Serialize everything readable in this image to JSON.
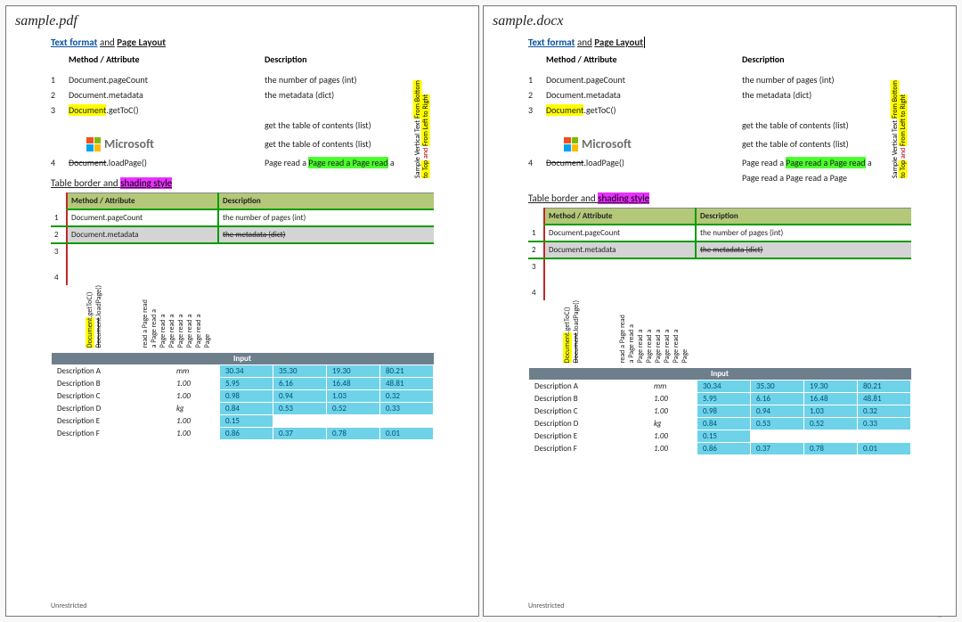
{
  "panes": [
    {
      "id": "left",
      "filename": "sample.pdf",
      "showCursor": false,
      "extraBottomRow": false
    },
    {
      "id": "right",
      "filename": "sample.docx",
      "showCursor": true,
      "extraBottomRow": true
    }
  ],
  "heading": {
    "part1": "Text format",
    "and": "and",
    "part2": "Page Layout"
  },
  "section1": {
    "colHeaders": {
      "method": "Method / Attribute",
      "desc": "Description"
    },
    "rows": [
      {
        "n": "1",
        "method_plain": "Document.pageCount",
        "desc": "the number of pages (int)"
      },
      {
        "n": "2",
        "method_plain": "Document.metadata",
        "desc": "the metadata (dict)"
      },
      {
        "n": "3",
        "method_hl": "Document",
        "method_tail": ".getToC()",
        "desc": ""
      }
    ],
    "contentsRows": [
      "get the table of contents (list)",
      "get the table of contents (list)"
    ],
    "row4": {
      "n": "4",
      "method_strike": "Document",
      "method_tail": ".loadPage()",
      "desc_pre": "Page read a ",
      "desc_hl": "Page read a Page read",
      "desc_post": " a",
      "desc_line2": "Page read a Page read a Page"
    },
    "vertical": {
      "black": "Sample Vertical Text ",
      "hl": "From Bottom",
      "line2_hl1": "to Top",
      "line2_mid": " and ",
      "line2_hl2": "From Left to Right"
    },
    "logo": "Microsoft"
  },
  "subhead": {
    "plain": "Table border and ",
    "hl": "shading style"
  },
  "styledTable": {
    "head": {
      "method": "Method / Attribute",
      "desc": "Description"
    },
    "r1": {
      "n": "1",
      "m": "Document.pageCount",
      "d": "the number of pages (int)"
    },
    "r2": {
      "n": "2",
      "m": "Document.metadata",
      "d": "the metadata (dict)"
    },
    "r3": {
      "n": "3"
    },
    "r4": {
      "n": "4"
    },
    "vcells_left": [
      {
        "hl": "Document",
        "tail": ".getToC()"
      },
      {
        "strike": "Document",
        "tail": ".loadPage()"
      }
    ],
    "vcells_right": [
      "read a Page read",
      "a Page read a",
      "Page read a",
      "Page read a",
      "Page read a",
      "Page read a",
      "Page read a",
      "Page"
    ]
  },
  "inputTable": {
    "title": "Input",
    "rows": [
      {
        "label": "Description A",
        "unit": "mm",
        "v": [
          "30.34",
          "35.30",
          "19.30",
          "80.21"
        ]
      },
      {
        "label": "Description B",
        "unit": "1.00",
        "v": [
          "5.95",
          "6.16",
          "16.48",
          "48.81"
        ]
      },
      {
        "label": "Description C",
        "unit": "1.00",
        "v": [
          "0.98",
          "0.94",
          "1.03",
          "0.32"
        ]
      },
      {
        "label": "Description D",
        "unit": "kg",
        "v": [
          "0.84",
          "0.53",
          "0.52",
          "0.33"
        ]
      },
      {
        "label": "Description E",
        "unit": "1.00",
        "v": [
          "0.15",
          "",
          "",
          ""
        ]
      },
      {
        "label": "Description F",
        "unit": "1.00",
        "v": [
          "0.86",
          "0.37",
          "0.78",
          "0.01"
        ]
      }
    ]
  },
  "footer": "Unrestricted",
  "watermark": "CSDN @KE5"
}
